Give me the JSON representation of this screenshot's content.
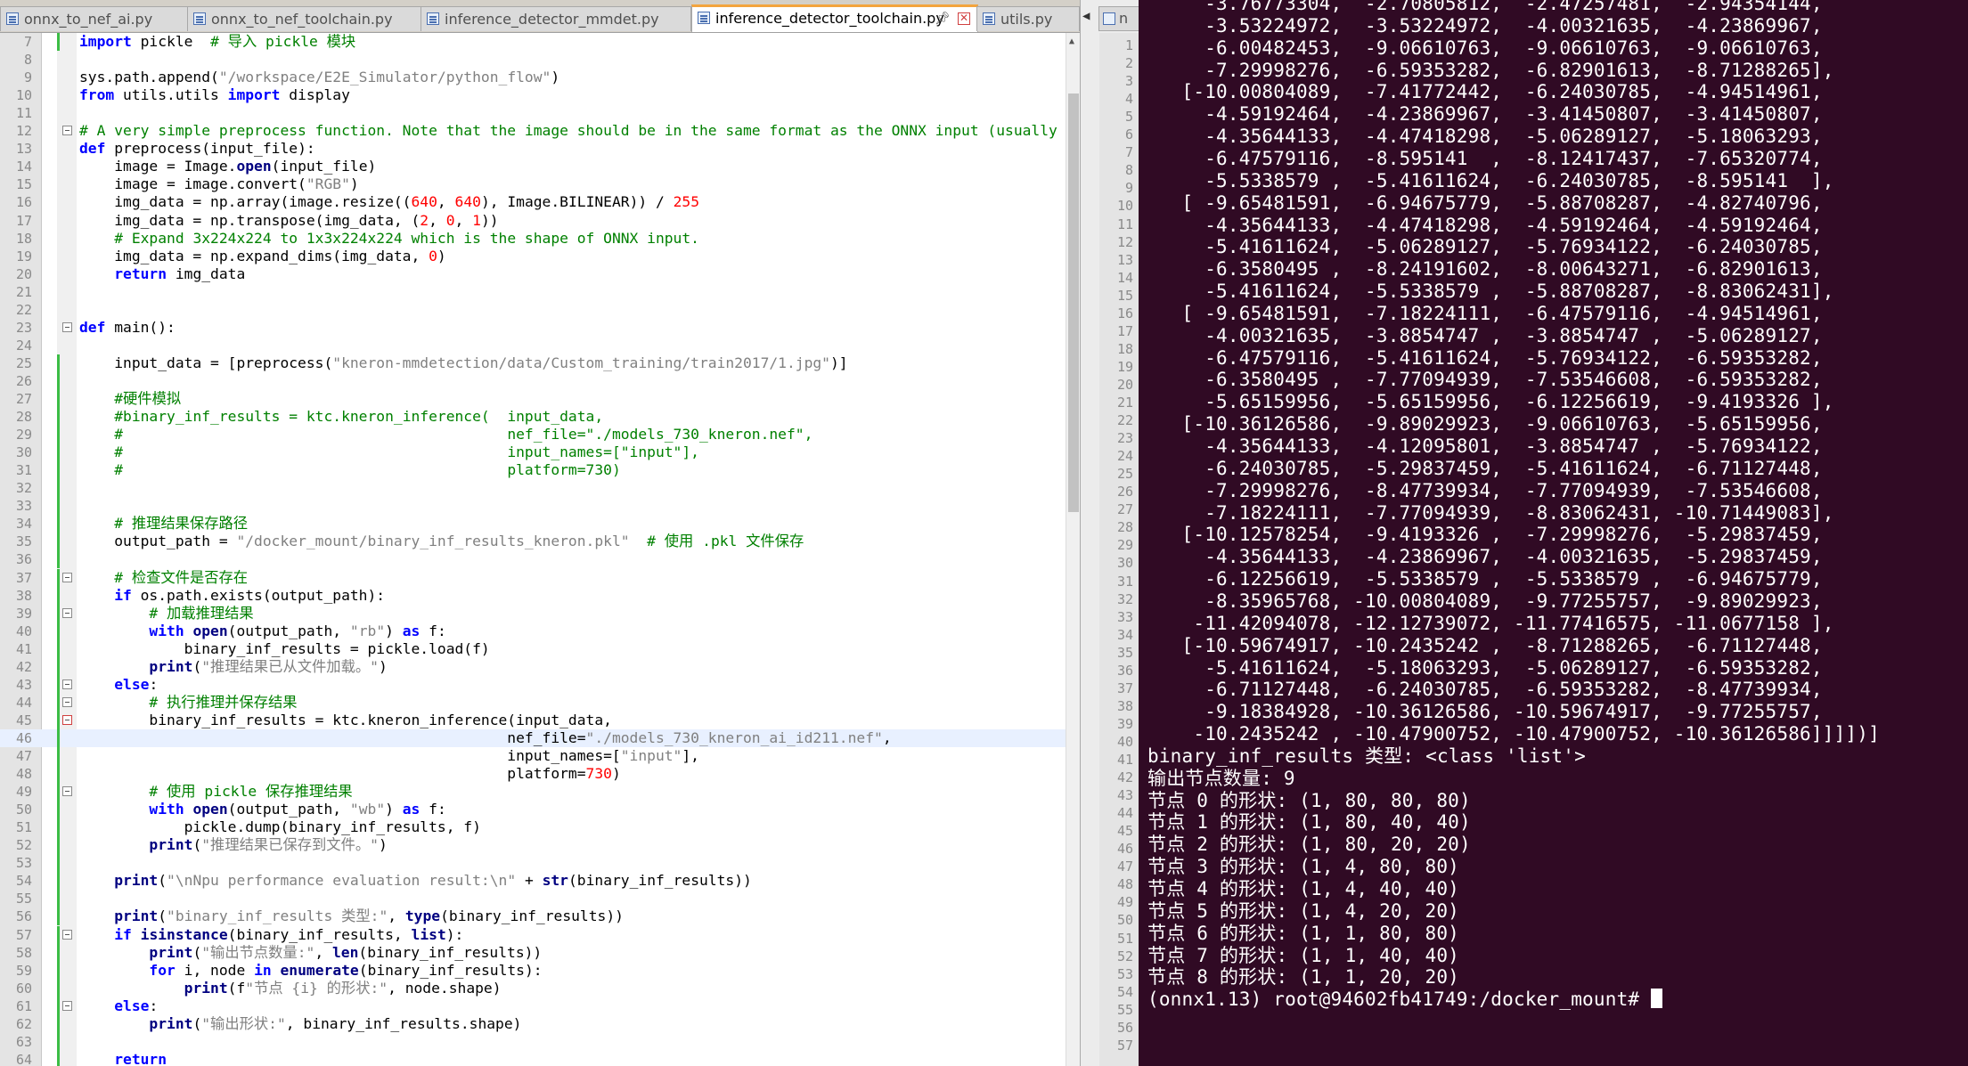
{
  "tabs": [
    {
      "label": "onnx_to_nef_ai.py",
      "active": false
    },
    {
      "label": "onnx_to_nef_toolchain.py",
      "active": false
    },
    {
      "label": "inference_detector_mmdet.py",
      "active": false
    },
    {
      "label": "inference_detector_toolchain.py",
      "active": true
    },
    {
      "label": "utils.py",
      "active": false
    }
  ],
  "mid_tab_label": "n",
  "code_lines": [
    {
      "n": "7",
      "t": "import pickle  # 导入 pickle 模块"
    },
    {
      "n": "8",
      "t": ""
    },
    {
      "n": "9",
      "t": "sys.path.append(\"/workspace/E2E_Simulator/python_flow\")"
    },
    {
      "n": "10",
      "t": "from utils.utils import display"
    },
    {
      "n": "11",
      "t": ""
    },
    {
      "n": "12",
      "t": "# A very simple preprocess function. Note that the image should be in the same format as the ONNX input (usually"
    },
    {
      "n": "13",
      "t": "def preprocess(input_file):"
    },
    {
      "n": "14",
      "t": "    image = Image.open(input_file)"
    },
    {
      "n": "15",
      "t": "    image = image.convert(\"RGB\")"
    },
    {
      "n": "16",
      "t": "    img_data = np.array(image.resize((640, 640), Image.BILINEAR)) / 255"
    },
    {
      "n": "17",
      "t": "    img_data = np.transpose(img_data, (2, 0, 1))"
    },
    {
      "n": "18",
      "t": "    # Expand 3x224x224 to 1x3x224x224 which is the shape of ONNX input."
    },
    {
      "n": "19",
      "t": "    img_data = np.expand_dims(img_data, 0)"
    },
    {
      "n": "20",
      "t": "    return img_data"
    },
    {
      "n": "21",
      "t": ""
    },
    {
      "n": "22",
      "t": ""
    },
    {
      "n": "23",
      "t": "def main():"
    },
    {
      "n": "24",
      "t": ""
    },
    {
      "n": "25",
      "t": "    input_data = [preprocess(\"kneron-mmdetection/data/Custom_training/train2017/1.jpg\")]"
    },
    {
      "n": "26",
      "t": ""
    },
    {
      "n": "27",
      "t": "    #硬件模拟"
    },
    {
      "n": "28",
      "t": "    #binary_inf_results = ktc.kneron_inference(  input_data,"
    },
    {
      "n": "29",
      "t": "    #                                            nef_file=\"./models_730_kneron.nef\","
    },
    {
      "n": "30",
      "t": "    #                                            input_names=[\"input\"],"
    },
    {
      "n": "31",
      "t": "    #                                            platform=730)"
    },
    {
      "n": "32",
      "t": ""
    },
    {
      "n": "33",
      "t": ""
    },
    {
      "n": "34",
      "t": "    # 推理结果保存路径"
    },
    {
      "n": "35",
      "t": "    output_path = \"/docker_mount/binary_inf_results_kneron.pkl\"  # 使用 .pkl 文件保存"
    },
    {
      "n": "36",
      "t": ""
    },
    {
      "n": "37",
      "t": "    # 检查文件是否存在"
    },
    {
      "n": "38",
      "t": "    if os.path.exists(output_path):"
    },
    {
      "n": "39",
      "t": "        # 加载推理结果"
    },
    {
      "n": "40",
      "t": "        with open(output_path, \"rb\") as f:"
    },
    {
      "n": "41",
      "t": "            binary_inf_results = pickle.load(f)"
    },
    {
      "n": "42",
      "t": "        print(\"推理结果已从文件加载。\")"
    },
    {
      "n": "43",
      "t": "    else:"
    },
    {
      "n": "44",
      "t": "        # 执行推理并保存结果"
    },
    {
      "n": "45",
      "t": "        binary_inf_results = ktc.kneron_inference(input_data,"
    },
    {
      "n": "46",
      "t": "                                                 nef_file=\"./models_730_kneron_ai_id211.nef\","
    },
    {
      "n": "47",
      "t": "                                                 input_names=[\"input\"],"
    },
    {
      "n": "48",
      "t": "                                                 platform=730)"
    },
    {
      "n": "49",
      "t": "        # 使用 pickle 保存推理结果"
    },
    {
      "n": "50",
      "t": "        with open(output_path, \"wb\") as f:"
    },
    {
      "n": "51",
      "t": "            pickle.dump(binary_inf_results, f)"
    },
    {
      "n": "52",
      "t": "        print(\"推理结果已保存到文件。\")"
    },
    {
      "n": "53",
      "t": ""
    },
    {
      "n": "54",
      "t": "    print(\"\\nNpu performance evaluation result:\\n\" + str(binary_inf_results))"
    },
    {
      "n": "55",
      "t": ""
    },
    {
      "n": "56",
      "t": "    print(\"binary_inf_results 类型:\", type(binary_inf_results))"
    },
    {
      "n": "57",
      "t": "    if isinstance(binary_inf_results, list):"
    },
    {
      "n": "58",
      "t": "        print(\"输出节点数量:\", len(binary_inf_results))"
    },
    {
      "n": "59",
      "t": "        for i, node in enumerate(binary_inf_results):"
    },
    {
      "n": "60",
      "t": "            print(f\"节点 {i} 的形状:\", node.shape)"
    },
    {
      "n": "61",
      "t": "    else:"
    },
    {
      "n": "62",
      "t": "        print(\"输出形状:\", binary_inf_results.shape)"
    },
    {
      "n": "63",
      "t": ""
    },
    {
      "n": "64",
      "t": "    return"
    }
  ],
  "mid_line_numbers": [
    "1",
    "2",
    "3",
    "4",
    "5",
    "6",
    "7",
    "8",
    "9",
    "10",
    "11",
    "12",
    "13",
    "14",
    "15",
    "16",
    "17",
    "18",
    "19",
    "20",
    "21",
    "22",
    "23",
    "24",
    "25",
    "26",
    "27",
    "28",
    "29",
    "30",
    "31",
    "32",
    "33",
    "34",
    "35",
    "36",
    "37",
    "38",
    "39",
    "40",
    "41",
    "42",
    "43",
    "44",
    "45",
    "46",
    "47",
    "48",
    "49",
    "50",
    "51",
    "52",
    "53",
    "54",
    "55",
    "56",
    "57"
  ],
  "terminal_lines": [
    "     -3.76773304,  -2.70805812,  -2.47257481,  -2.94354144,",
    "     -3.53224972,  -3.53224972,  -4.00321635,  -4.23869967,",
    "     -6.00482453,  -9.06610763,  -9.06610763,  -9.06610763,",
    "     -7.29998276,  -6.59353282,  -6.82901613,  -8.71288265],",
    "   [-10.00804089,  -7.41772442,  -6.24030785,  -4.94514961,",
    "     -4.59192464,  -4.23869967,  -3.41450807,  -3.41450807,",
    "     -4.35644133,  -4.47418298,  -5.06289127,  -5.18063293,",
    "     -6.47579116,  -8.595141  ,  -8.12417437,  -7.65320774,",
    "     -5.5338579 ,  -5.41611624,  -6.24030785,  -8.595141  ],",
    "   [ -9.65481591,  -6.94675779,  -5.88708287,  -4.82740796,",
    "     -4.35644133,  -4.47418298,  -4.59192464,  -4.59192464,",
    "     -5.41611624,  -5.06289127,  -5.76934122,  -6.24030785,",
    "     -6.3580495 ,  -8.24191602,  -8.00643271,  -6.82901613,",
    "     -5.41611624,  -5.5338579 ,  -5.88708287,  -8.83062431],",
    "   [ -9.65481591,  -7.18224111,  -6.47579116,  -4.94514961,",
    "     -4.00321635,  -3.8854747 ,  -3.8854747 ,  -5.06289127,",
    "     -6.47579116,  -5.41611624,  -5.76934122,  -6.59353282,",
    "     -6.3580495 ,  -7.77094939,  -7.53546608,  -6.59353282,",
    "     -5.65159956,  -5.65159956,  -6.12256619,  -9.4193326 ],",
    "   [-10.36126586,  -9.89029923,  -9.06610763,  -5.65159956,",
    "     -4.35644133,  -4.12095801,  -3.8854747 ,  -5.76934122,",
    "     -6.24030785,  -5.29837459,  -5.41611624,  -6.71127448,",
    "     -7.29998276,  -8.47739934,  -7.77094939,  -7.53546608,",
    "     -7.18224111,  -7.77094939,  -8.83062431, -10.71449083],",
    "   [-10.12578254,  -9.4193326 ,  -7.29998276,  -5.29837459,",
    "     -4.35644133,  -4.23869967,  -4.00321635,  -5.29837459,",
    "     -6.12256619,  -5.5338579 ,  -5.5338579 ,  -6.94675779,",
    "     -8.35965768, -10.00804089,  -9.77255757,  -9.89029923,",
    "    -11.42094078, -12.12739072, -11.77416575, -11.0677158 ],",
    "   [-10.59674917, -10.2435242 ,  -8.71288265,  -6.71127448,",
    "     -5.41611624,  -5.18063293,  -5.06289127,  -6.59353282,",
    "     -6.71127448,  -6.24030785,  -6.59353282,  -8.47739934,",
    "     -9.18384928, -10.36126586, -10.59674917,  -9.77255757,",
    "    -10.2435242 , -10.47900752, -10.47900752, -10.36126586]]]])]",
    "binary_inf_results 类型: <class 'list'>",
    "输出节点数量: 9",
    "节点 0 的形状: (1, 80, 80, 80)",
    "节点 1 的形状: (1, 80, 40, 40)",
    "节点 2 的形状: (1, 80, 20, 20)",
    "节点 3 的形状: (1, 4, 80, 80)",
    "节点 4 的形状: (1, 4, 40, 40)",
    "节点 5 的形状: (1, 4, 20, 20)",
    "节点 6 的形状: (1, 1, 80, 80)",
    "节点 7 的形状: (1, 1, 40, 40)",
    "节点 8 的形状: (1, 1, 20, 20)"
  ],
  "prompt": "(onnx1.13) root@94602fb41749:/docker_mount# ",
  "colors": {
    "terminal_bg": "#300a24",
    "active_tab_accent": "#f3a43d",
    "change_bar": "#3cbd46"
  }
}
